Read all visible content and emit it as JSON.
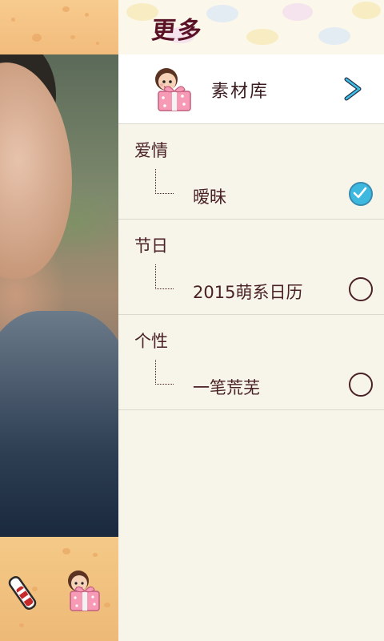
{
  "header": {
    "title": "更多"
  },
  "library": {
    "label": "素材库"
  },
  "categories": [
    {
      "title": "爱情",
      "item": "暧昧",
      "selected": true
    },
    {
      "title": "节日",
      "item": "2015萌系日历",
      "selected": false
    },
    {
      "title": "个性",
      "item": "一笔荒芜",
      "selected": false
    }
  ],
  "colors": {
    "accent": "#3db9e0",
    "text": "#4a2126",
    "panel_bg": "#f7f5e9"
  },
  "icons": {
    "library": "gift-girl-icon",
    "library_open": "chevron-right-icon",
    "bottom_left": "paint-tool-icon",
    "bottom_right": "gift-girl-sticker-icon"
  }
}
